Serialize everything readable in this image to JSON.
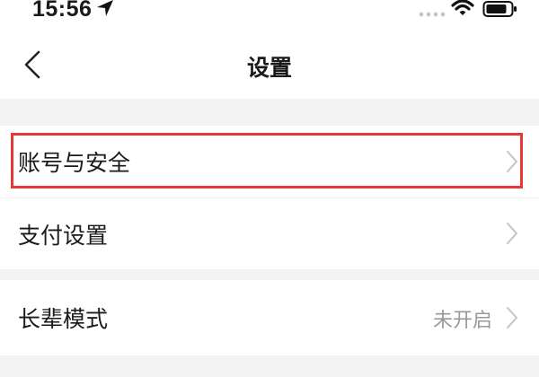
{
  "status_bar": {
    "time": "15:56",
    "icons": [
      "location-arrow-icon",
      "signal-icon",
      "wifi-icon",
      "battery-icon"
    ]
  },
  "nav": {
    "title": "设置",
    "back_icon": "chevron-left-icon"
  },
  "groups": [
    {
      "items": [
        {
          "label": "账号与安全",
          "highlighted": true
        },
        {
          "label": "支付设置"
        }
      ]
    },
    {
      "items": [
        {
          "label": "长辈模式",
          "value": "未开启"
        }
      ]
    }
  ],
  "colors": {
    "highlight_border": "#e53935",
    "page_background": "#f3f3f3",
    "row_background": "#ffffff",
    "secondary_text": "#999999"
  }
}
